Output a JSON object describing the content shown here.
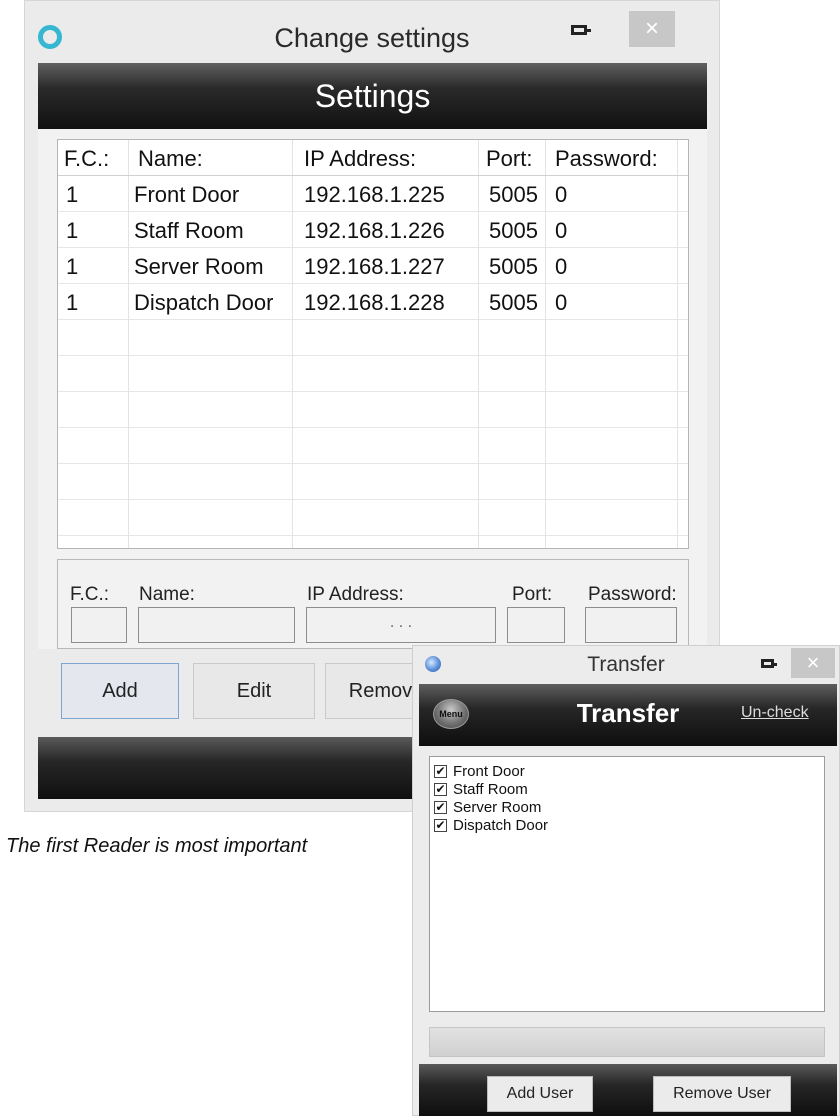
{
  "settings_window": {
    "title": "Change settings",
    "close_glyph": "×",
    "header": "Settings",
    "columns": [
      "F.C.:",
      "Name:",
      "IP Address:",
      "Port:",
      "Password:"
    ],
    "rows": [
      [
        "1",
        "Front Door",
        "192.168.1.225",
        "5005",
        "0"
      ],
      [
        "1",
        "Staff Room",
        "192.168.1.226",
        "5005",
        "0"
      ],
      [
        "1",
        "Server Room",
        "192.168.1.227",
        "5005",
        "0"
      ],
      [
        "1",
        "Dispatch Door",
        "192.168.1.228",
        "5005",
        "0"
      ]
    ],
    "edit_labels": {
      "fc": "F.C.:",
      "name": "Name:",
      "ip": "IP Address:",
      "port": "Port:",
      "password": "Password:"
    },
    "ip_placeholder": ".     .     .",
    "buttons": {
      "add": "Add",
      "edit": "Edit",
      "remove": "Remove"
    },
    "accent_color": "#35b6d1"
  },
  "caption": "The first Reader is most important",
  "transfer_window": {
    "title": "Transfer",
    "close_glyph": "×",
    "menu_label": "Menu",
    "header": "Transfer",
    "uncheck_label": "Un-check",
    "items": [
      {
        "label": "Front Door",
        "checked": true
      },
      {
        "label": "Staff Room",
        "checked": true
      },
      {
        "label": "Server Room",
        "checked": true
      },
      {
        "label": "Dispatch Door",
        "checked": true
      }
    ],
    "check_glyph": "✔",
    "buttons": {
      "add_user": "Add User",
      "remove_user": "Remove User"
    }
  }
}
